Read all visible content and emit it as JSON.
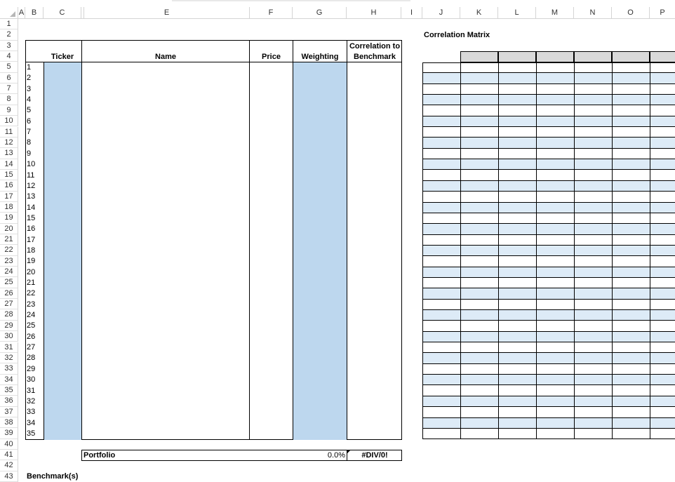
{
  "columns": [
    "A",
    "B",
    "C",
    "E",
    "F",
    "G",
    "H",
    "I",
    "J",
    "K",
    "L",
    "M",
    "N",
    "O",
    "P"
  ],
  "rows": [
    "1",
    "2",
    "3",
    "4",
    "5",
    "6",
    "7",
    "8",
    "9",
    "10",
    "11",
    "12",
    "13",
    "14",
    "15",
    "16",
    "17",
    "18",
    "19",
    "20",
    "21",
    "22",
    "23",
    "24",
    "25",
    "26",
    "27",
    "28",
    "29",
    "30",
    "31",
    "32",
    "33",
    "34",
    "35",
    "36",
    "37",
    "38",
    "39",
    "40",
    "41",
    "42",
    "43"
  ],
  "table": {
    "ticker_header": "Ticker",
    "name_header": "Name",
    "price_header": "Price",
    "weighting_header": "Weighting",
    "correlation_header_line1": "Correlation to",
    "correlation_header_line2": "Benchmark",
    "row_numbers": [
      "1",
      "2",
      "3",
      "4",
      "5",
      "6",
      "7",
      "8",
      "9",
      "10",
      "11",
      "12",
      "13",
      "14",
      "15",
      "16",
      "17",
      "18",
      "19",
      "20",
      "21",
      "22",
      "23",
      "24",
      "25",
      "26",
      "27",
      "28",
      "29",
      "30",
      "31",
      "32",
      "33",
      "34",
      "35"
    ]
  },
  "portfolio": {
    "label": "Portfolio",
    "weighting": "0.0%",
    "correlation": "#DIV/0!"
  },
  "correlation_matrix": {
    "title": "Correlation Matrix"
  },
  "benchmark": {
    "label": "Benchmark(s)"
  },
  "colors": {
    "ticker_fill": "#bdd7ee",
    "matrix_band": "#ddebf7",
    "matrix_header": "#d9d9d9"
  }
}
